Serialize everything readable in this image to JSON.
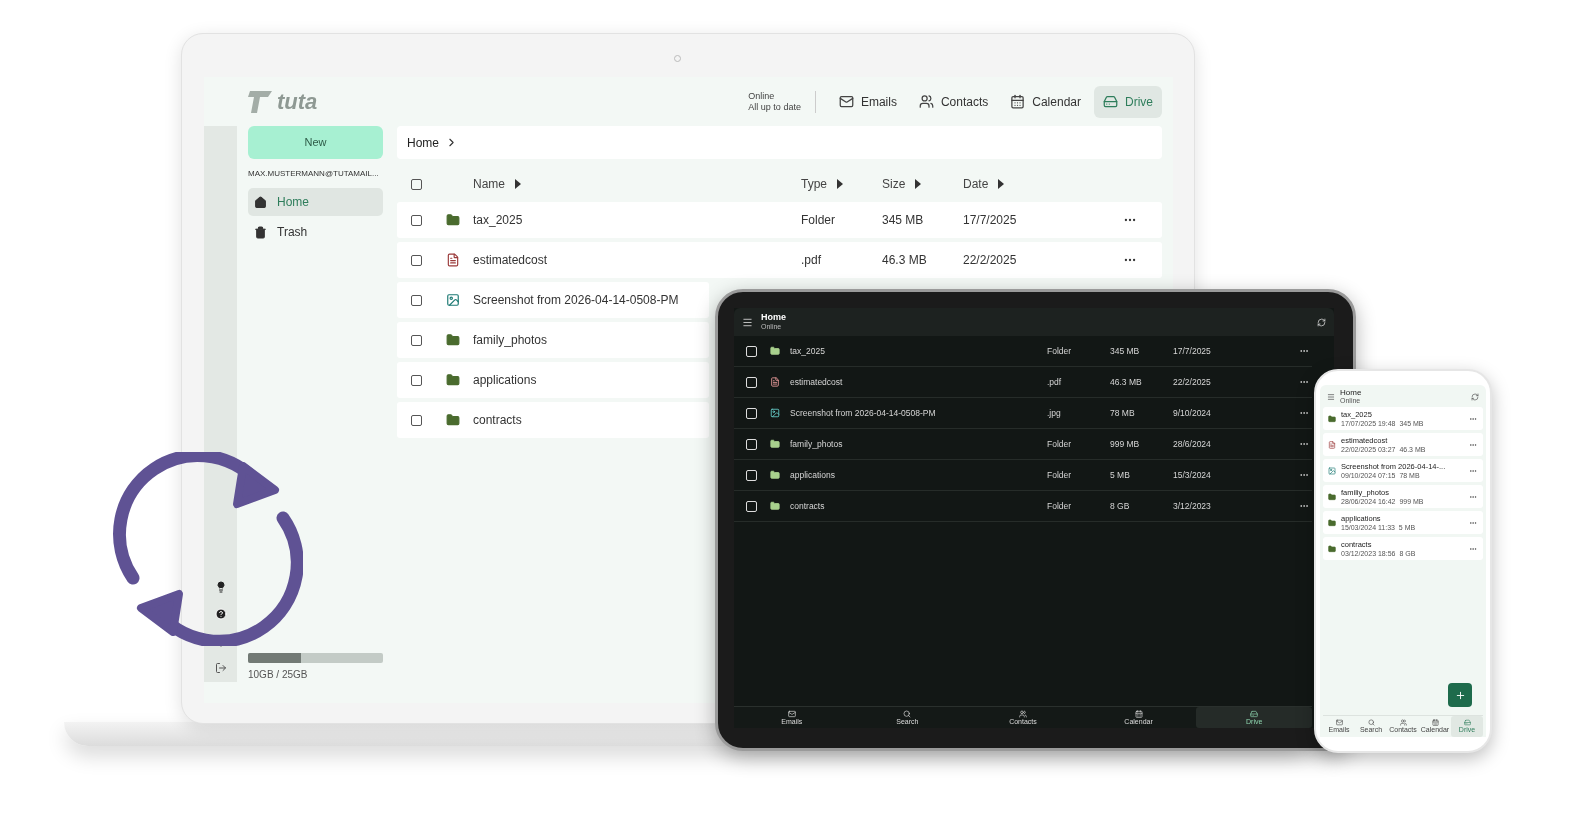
{
  "laptop": {
    "logo": "tuta",
    "status_lines": [
      "Online",
      "All up to date"
    ],
    "nav": [
      {
        "label": "Emails",
        "selected": false
      },
      {
        "label": "Contacts",
        "selected": false
      },
      {
        "label": "Calendar",
        "selected": false
      },
      {
        "label": "Drive",
        "selected": true
      }
    ],
    "new_button": "New",
    "account": "MAX.MUSTERMANN@TUTAMAIL...",
    "sidebar": {
      "items": [
        {
          "label": "Home",
          "selected": true
        },
        {
          "label": "Trash",
          "selected": false
        }
      ]
    },
    "storage": {
      "level": 0.39,
      "label": "10GB / 25GB"
    },
    "breadcrumb": "Home",
    "columns": [
      "Name",
      "Type",
      "Size",
      "Date"
    ],
    "select_all_checked": false,
    "rows": [
      {
        "kind": "folder",
        "name": "tax_2025",
        "type": "Folder",
        "size": "345 MB",
        "date": "17/7/2025",
        "checked": false
      },
      {
        "kind": "pdf",
        "name": "estimatedcost",
        "type": ".pdf",
        "size": "46.3 MB",
        "date": "22/2/2025",
        "checked": false
      },
      {
        "kind": "image",
        "name": "Screenshot from 2026-04-14-0508-PM",
        "checked": false
      },
      {
        "kind": "folder",
        "name": "family_photos",
        "checked": false
      },
      {
        "kind": "folder",
        "name": "applications",
        "checked": false
      },
      {
        "kind": "folder",
        "name": "contracts",
        "checked": false
      }
    ]
  },
  "tablet": {
    "title": "Home",
    "subtitle": "Online",
    "rows": [
      {
        "kind": "folder",
        "name": "tax_2025",
        "type": "Folder",
        "size": "345 MB",
        "date": "17/7/2025",
        "checked": false
      },
      {
        "kind": "pdf",
        "name": "estimatedcost",
        "type": ".pdf",
        "size": "46.3 MB",
        "date": "22/2/2025",
        "checked": false
      },
      {
        "kind": "image",
        "name": "Screenshot from 2026-04-14-0508-PM",
        "type": ".jpg",
        "size": "78 MB",
        "date": "9/10/2024",
        "checked": false
      },
      {
        "kind": "folder",
        "name": "family_photos",
        "type": "Folder",
        "size": "999 MB",
        "date": "28/6/2024",
        "checked": false
      },
      {
        "kind": "folder",
        "name": "applications",
        "type": "Folder",
        "size": "5 MB",
        "date": "15/3/2024",
        "checked": false
      },
      {
        "kind": "folder",
        "name": "contracts",
        "type": "Folder",
        "size": "8 GB",
        "date": "3/12/2023",
        "checked": false
      }
    ],
    "nav": [
      {
        "label": "Emails",
        "selected": false
      },
      {
        "label": "Search",
        "selected": false
      },
      {
        "label": "Contacts",
        "selected": false
      },
      {
        "label": "Calendar",
        "selected": false
      },
      {
        "label": "Drive",
        "selected": true
      }
    ]
  },
  "phone": {
    "title": "Home",
    "subtitle": "Online",
    "rows": [
      {
        "kind": "folder",
        "name": "tax_2025",
        "meta": "17/07/2025 19:48  345 MB"
      },
      {
        "kind": "pdf",
        "name": "estimatedcost",
        "meta": "22/02/2025 03:27  46.3 MB"
      },
      {
        "kind": "image",
        "name": "Screenshot from 2026-04-14-...",
        "meta": "09/10/2024 07:15  78 MB"
      },
      {
        "kind": "folder",
        "name": "familiy_photos",
        "meta": "28/06/2024 16:42  999 MB"
      },
      {
        "kind": "folder",
        "name": "applications",
        "meta": "15/03/2024 11:33  5 MB"
      },
      {
        "kind": "folder",
        "name": "contracts",
        "meta": "03/12/2023 18:56  8 GB"
      }
    ],
    "nav": [
      {
        "label": "Emails",
        "selected": false
      },
      {
        "label": "Search",
        "selected": false
      },
      {
        "label": "Contacts",
        "selected": false
      },
      {
        "label": "Calendar",
        "selected": false
      },
      {
        "label": "Drive",
        "selected": true
      }
    ]
  }
}
